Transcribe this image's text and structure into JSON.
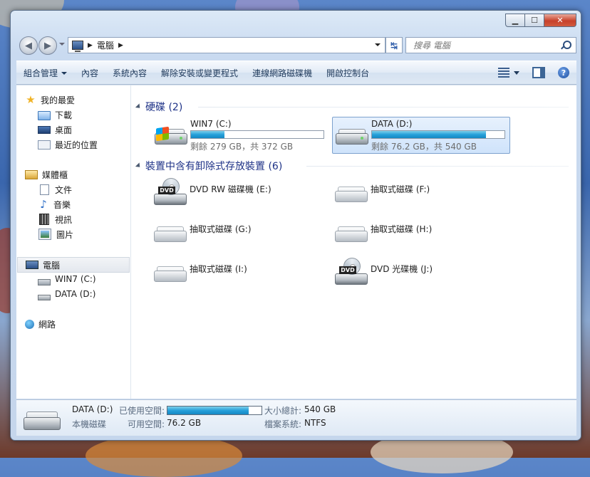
{
  "window": {
    "caption": {
      "minimize": "▁",
      "maximize": "☐",
      "close": "✕"
    }
  },
  "navbar": {
    "back_icon": "back-arrow-icon",
    "forward_icon": "forward-arrow-icon",
    "address_sep": "▶",
    "address_text": "電腦",
    "refresh_icon": "↹",
    "search_placeholder": "搜尋 電腦"
  },
  "toolbar": {
    "items": [
      "組合管理",
      "內容",
      "系統內容",
      "解除安裝或變更程式",
      "連線網路磁碟機",
      "開啟控制台"
    ],
    "help_label": "?"
  },
  "sidebar": {
    "favorites": {
      "label": "我的最愛",
      "items": [
        "下載",
        "桌面",
        "最近的位置"
      ]
    },
    "libraries": {
      "label": "媒體櫃",
      "items": [
        "文件",
        "音樂",
        "視訊",
        "圖片"
      ]
    },
    "computer": {
      "label": "電腦",
      "items": [
        "WIN7 (C:)",
        "DATA (D:)"
      ]
    },
    "network": {
      "label": "網路"
    }
  },
  "content": {
    "hdd_group": {
      "title": "硬碟 (2)",
      "drives": [
        {
          "name": "WIN7 (C:)",
          "free_text": "剩餘 279 GB，共 372 GB",
          "used_fraction": 0.25,
          "selected": false
        },
        {
          "name": "DATA (D:)",
          "free_text": "剩餘 76.2 GB，共 540 GB",
          "used_fraction": 0.86,
          "selected": true
        }
      ]
    },
    "removable_group": {
      "title": "裝置中含有卸除式存放裝置 (6)",
      "devices": [
        {
          "name": "DVD RW 磁碟機 (E:)",
          "type": "dvd",
          "badge": "DVD"
        },
        {
          "name": "抽取式磁碟 (F:)",
          "type": "removable"
        },
        {
          "name": "抽取式磁碟 (G:)",
          "type": "removable"
        },
        {
          "name": "抽取式磁碟 (H:)",
          "type": "removable"
        },
        {
          "name": "抽取式磁碟 (I:)",
          "type": "removable"
        },
        {
          "name": "DVD 光碟機 (J:)",
          "type": "dvd",
          "badge": "DVD"
        }
      ]
    }
  },
  "details": {
    "name": "DATA (D:)",
    "type": "本機磁碟",
    "used_label": "已使用空間:",
    "free_label": "可用空間:",
    "free_value": "76.2 GB",
    "total_label": "大小總計:",
    "total_value": "540 GB",
    "fs_label": "檔案系統:",
    "fs_value": "NTFS",
    "used_fraction": 0.86
  }
}
